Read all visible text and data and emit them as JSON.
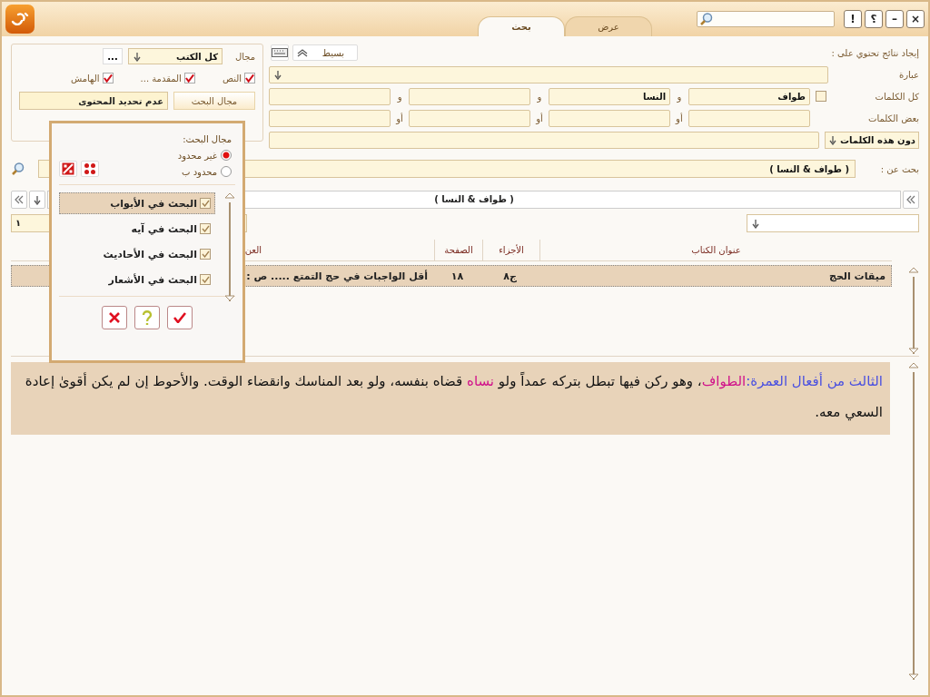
{
  "title_bar": {
    "tabs": [
      {
        "label": "عرض",
        "selected": false
      },
      {
        "label": "بحث",
        "selected": true
      }
    ],
    "buttons": [
      "×",
      "–",
      "؟",
      "!"
    ]
  },
  "scope_box": {
    "label": "مجال",
    "value": "كل الكتب",
    "more": "...",
    "checks": [
      {
        "label": "النص",
        "checked": true
      },
      {
        "label": "المقدمة ...",
        "checked": true
      },
      {
        "label": "الهامش",
        "checked": true
      }
    ],
    "scope_button": "مجال البحث",
    "scope_value": "عدم تحديد المحتوى"
  },
  "search_form": {
    "heading": "إيجاد نتائج تحتوي على :",
    "mode": "بسيط",
    "phrase_label": "عبارة",
    "all_words": {
      "label": "كل الكلمات",
      "checked": false,
      "joiners": [
        "و",
        "و",
        "و"
      ],
      "values": [
        "طواف",
        "النسا"
      ]
    },
    "some_words": {
      "label": "بعض الكلمات",
      "joiners": [
        "أو",
        "أو",
        "أو"
      ]
    },
    "exclude_mode": "دون هذه الكلمات"
  },
  "query": {
    "label": "بحث عن :",
    "value": "( طواف  & النسا )"
  },
  "expression": "( طواف  & النسا )",
  "page_field": "١",
  "table": {
    "columns": [
      "عنوان الكتاب",
      "الأجزاء",
      "الصفحة",
      "العن"
    ],
    "rows": [
      {
        "selected": true,
        "cells": [
          "ميقات الحج",
          "ج٨",
          "١٨",
          "أقل الواجبات في حج التمتع ..... ص :"
        ]
      }
    ]
  },
  "passage": [
    {
      "kind": "heading",
      "text": "الثالث من أفعال العمرة:"
    },
    {
      "kind": "hit",
      "text": "الطواف"
    },
    {
      "kind": "plain",
      "text": "، وهو ركن فيها تبطل بتركه عمداً ولو "
    },
    {
      "kind": "hit",
      "text": "نساه"
    },
    {
      "kind": "plain",
      "text": " قضاه بنفسه، ولو بعد المناسك وانقضاء الوقت. والأحوط إن لم يكن أقوىٰ إعادة السعي معه."
    }
  ],
  "popup": {
    "title": "مجال البحث:",
    "radios": [
      {
        "label": "غير محدود",
        "selected": true
      },
      {
        "label": "محدود ب",
        "selected": false
      }
    ],
    "items": [
      {
        "label": "البحث في الأبواب",
        "checked": true,
        "selected": true
      },
      {
        "label": "البحث في آيه",
        "checked": true,
        "selected": false
      },
      {
        "label": "البحث في الأحاديث",
        "checked": true,
        "selected": false
      },
      {
        "label": "البحث في الأشعار",
        "checked": true,
        "selected": false
      }
    ]
  }
}
